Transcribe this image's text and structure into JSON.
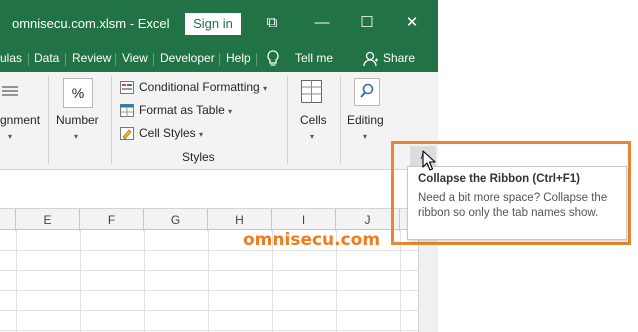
{
  "titlebar": {
    "filename": "omnisecu.com.xlsm - Excel",
    "signin_label": "Sign in",
    "restore_glyph": "⧉",
    "minimize_glyph": "—",
    "maximize_glyph": "☐",
    "close_glyph": "✕"
  },
  "tabs": {
    "items": [
      "ulas",
      "Data",
      "Review",
      "View",
      "Developer",
      "Help"
    ],
    "tellme_label": "Tell me",
    "share_label": "Share"
  },
  "ribbon": {
    "alignment_label": "gnment",
    "number_label": "Number",
    "number_glyph": "%",
    "conditional_formatting": "Conditional Formatting",
    "format_as_table": "Format as Table",
    "cell_styles": "Cell Styles",
    "styles_group": "Styles",
    "cells_label": "Cells",
    "editing_label": "Editing",
    "collapse_glyph": "∧"
  },
  "grid": {
    "columns": [
      "E",
      "F",
      "G",
      "H",
      "I",
      "J"
    ]
  },
  "tooltip": {
    "title": "Collapse the Ribbon (Ctrl+F1)",
    "body": "Need a bit more space? Collapse the ribbon so only the tab names show."
  },
  "watermark": "omnisecu.com",
  "colors": {
    "excel_green": "#217346",
    "highlight_orange": "#e8872f",
    "watermark_orange": "#f07c1e"
  }
}
